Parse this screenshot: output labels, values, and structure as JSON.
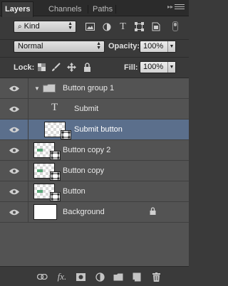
{
  "tabs": [
    {
      "label": "Layers",
      "active": true
    },
    {
      "label": "Channels",
      "active": false
    },
    {
      "label": "Paths",
      "active": false
    }
  ],
  "filter": {
    "kind_label": "Kind"
  },
  "blend": {
    "mode": "Normal",
    "opacity_label": "Opacity:",
    "opacity_value": "100%"
  },
  "lock": {
    "label": "Lock:",
    "fill_label": "Fill:",
    "fill_value": "100%"
  },
  "layers": [
    {
      "name": "Button group 1",
      "type": "group",
      "visible": true,
      "expanded": true
    },
    {
      "name": "Submit",
      "type": "text",
      "visible": true,
      "indent": true
    },
    {
      "name": "Submit button",
      "type": "smart-object",
      "visible": true,
      "indent": true,
      "selected": true
    },
    {
      "name": "Button copy 2",
      "type": "smart-object",
      "visible": true
    },
    {
      "name": "Button copy",
      "type": "smart-object",
      "visible": true
    },
    {
      "name": "Button",
      "type": "smart-object",
      "visible": true
    },
    {
      "name": "Background",
      "type": "background",
      "visible": true,
      "locked": true
    }
  ],
  "colors": {
    "panel": "#3a3a3a",
    "layer_bg": "#535353",
    "selected": "#5b6f8c"
  }
}
